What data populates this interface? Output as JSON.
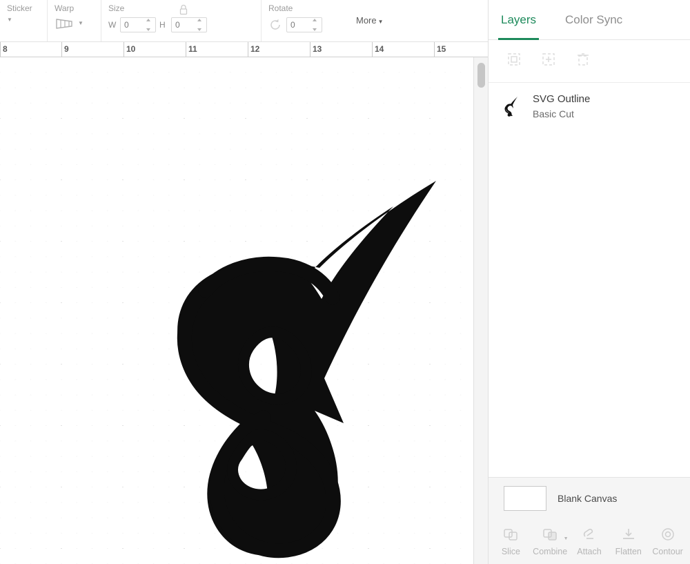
{
  "toolbar": {
    "groups": [
      {
        "label": "Sticker",
        "caret": "▼"
      },
      {
        "label": "Warp"
      },
      {
        "label": "Size",
        "w_label": "W",
        "w_value": "0",
        "h_label": "H",
        "h_value": "0",
        "lock_icon": "lock-icon"
      },
      {
        "label": "Rotate",
        "value": "0",
        "icon": "rotate-icon"
      }
    ],
    "more_label": "More",
    "more_caret": "▼"
  },
  "ruler": {
    "labels": [
      "8",
      "9",
      "10",
      "11",
      "12",
      "13",
      "14",
      "15"
    ],
    "unit": "inch"
  },
  "canvas": {
    "scroll_thumb": true,
    "artwork_name": "svg-outline-artwork"
  },
  "panel": {
    "tabs": [
      {
        "label": "Layers",
        "active": true
      },
      {
        "label": "Color Sync",
        "active": false
      }
    ],
    "layer_actions": [
      {
        "name": "group-icon"
      },
      {
        "name": "duplicate-icon"
      },
      {
        "name": "delete-icon"
      }
    ],
    "layers": [
      {
        "title": "SVG Outline",
        "subtitle": "Basic Cut",
        "thumb": "swan-glyph"
      }
    ],
    "canvas_row": {
      "label": "Blank Canvas",
      "swatch_color": "#ffffff"
    },
    "bottom_bar": [
      {
        "label": "Slice",
        "icon": "slice-icon",
        "dropdown": false
      },
      {
        "label": "Combine",
        "icon": "combine-icon",
        "dropdown": true
      },
      {
        "label": "Attach",
        "icon": "attach-icon",
        "dropdown": false
      },
      {
        "label": "Flatten",
        "icon": "flatten-icon",
        "dropdown": false
      },
      {
        "label": "Contour",
        "icon": "contour-icon",
        "dropdown": false
      }
    ]
  },
  "colors": {
    "accent": "#1d8a5b",
    "text_muted": "#9b9b9b",
    "panel_bg": "#f5f5f5"
  }
}
